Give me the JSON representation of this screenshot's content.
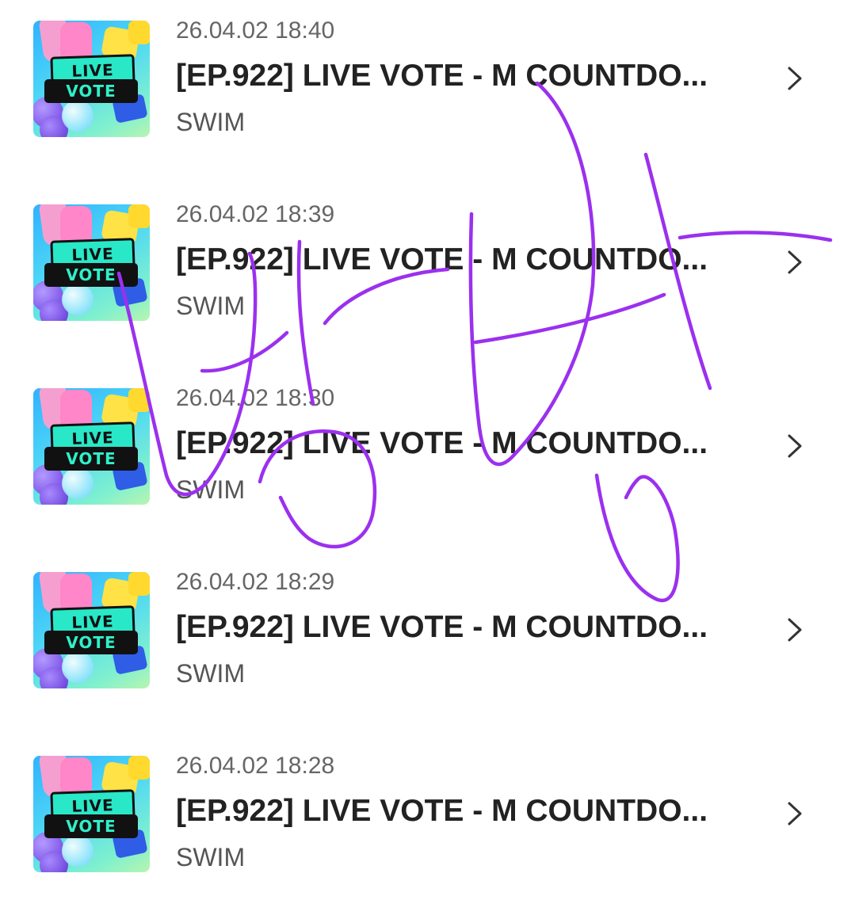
{
  "list": {
    "items": [
      {
        "timestamp": "26.04.02 18:40",
        "title": "[EP.922] LIVE VOTE - M COUNTDO...",
        "artist": "SWIM",
        "thumb_line1": "LIVE",
        "thumb_line2": "VOTE"
      },
      {
        "timestamp": "26.04.02 18:39",
        "title": "[EP.922] LIVE VOTE - M COUNTDO...",
        "artist": "SWIM",
        "thumb_line1": "LIVE",
        "thumb_line2": "VOTE"
      },
      {
        "timestamp": "26.04.02 18:30",
        "title": "[EP.922] LIVE VOTE - M COUNTDO...",
        "artist": "SWIM",
        "thumb_line1": "LIVE",
        "thumb_line2": "VOTE"
      },
      {
        "timestamp": "26.04.02 18:29",
        "title": "[EP.922] LIVE VOTE - M COUNTDO...",
        "artist": "SWIM",
        "thumb_line1": "LIVE",
        "thumb_line2": "VOTE"
      },
      {
        "timestamp": "26.04.02 18:28",
        "title": "[EP.922] LIVE VOTE - M COUNTDO...",
        "artist": "SWIM",
        "thumb_line1": "LIVE",
        "thumb_line2": "VOTE"
      }
    ],
    "chevron_icon": "chevron-right-icon"
  },
  "colors": {
    "text_primary": "#222222",
    "text_secondary": "#666666",
    "scribble": "#9b30ef"
  }
}
